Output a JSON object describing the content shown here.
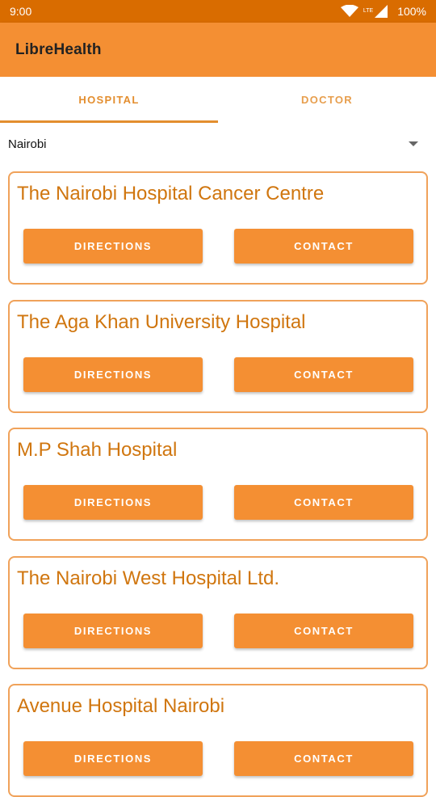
{
  "status_bar": {
    "time": "9:00",
    "network": "LTE",
    "battery": "100%"
  },
  "app_bar": {
    "title": "LibreHealth"
  },
  "tabs": [
    {
      "label": "HOSPITAL"
    },
    {
      "label": "DOCTOR"
    }
  ],
  "location_spinner": {
    "value": "Nairobi"
  },
  "hospitals": [
    {
      "name": "The Nairobi Hospital Cancer Centre",
      "directions_label": "DIRECTIONS",
      "contact_label": "CONTACT"
    },
    {
      "name": "The Aga Khan University Hospital",
      "directions_label": "DIRECTIONS",
      "contact_label": "CONTACT"
    },
    {
      "name": "M.P Shah Hospital",
      "directions_label": "DIRECTIONS",
      "contact_label": "CONTACT"
    },
    {
      "name": "The Nairobi West Hospital Ltd.",
      "directions_label": "DIRECTIONS",
      "contact_label": "CONTACT"
    },
    {
      "name": "Avenue Hospital Nairobi",
      "directions_label": "DIRECTIONS",
      "contact_label": "CONTACT"
    }
  ],
  "colors": {
    "primary": "#F48F33",
    "primary_dark": "#D96C00",
    "accent_text": "#D0760F"
  }
}
